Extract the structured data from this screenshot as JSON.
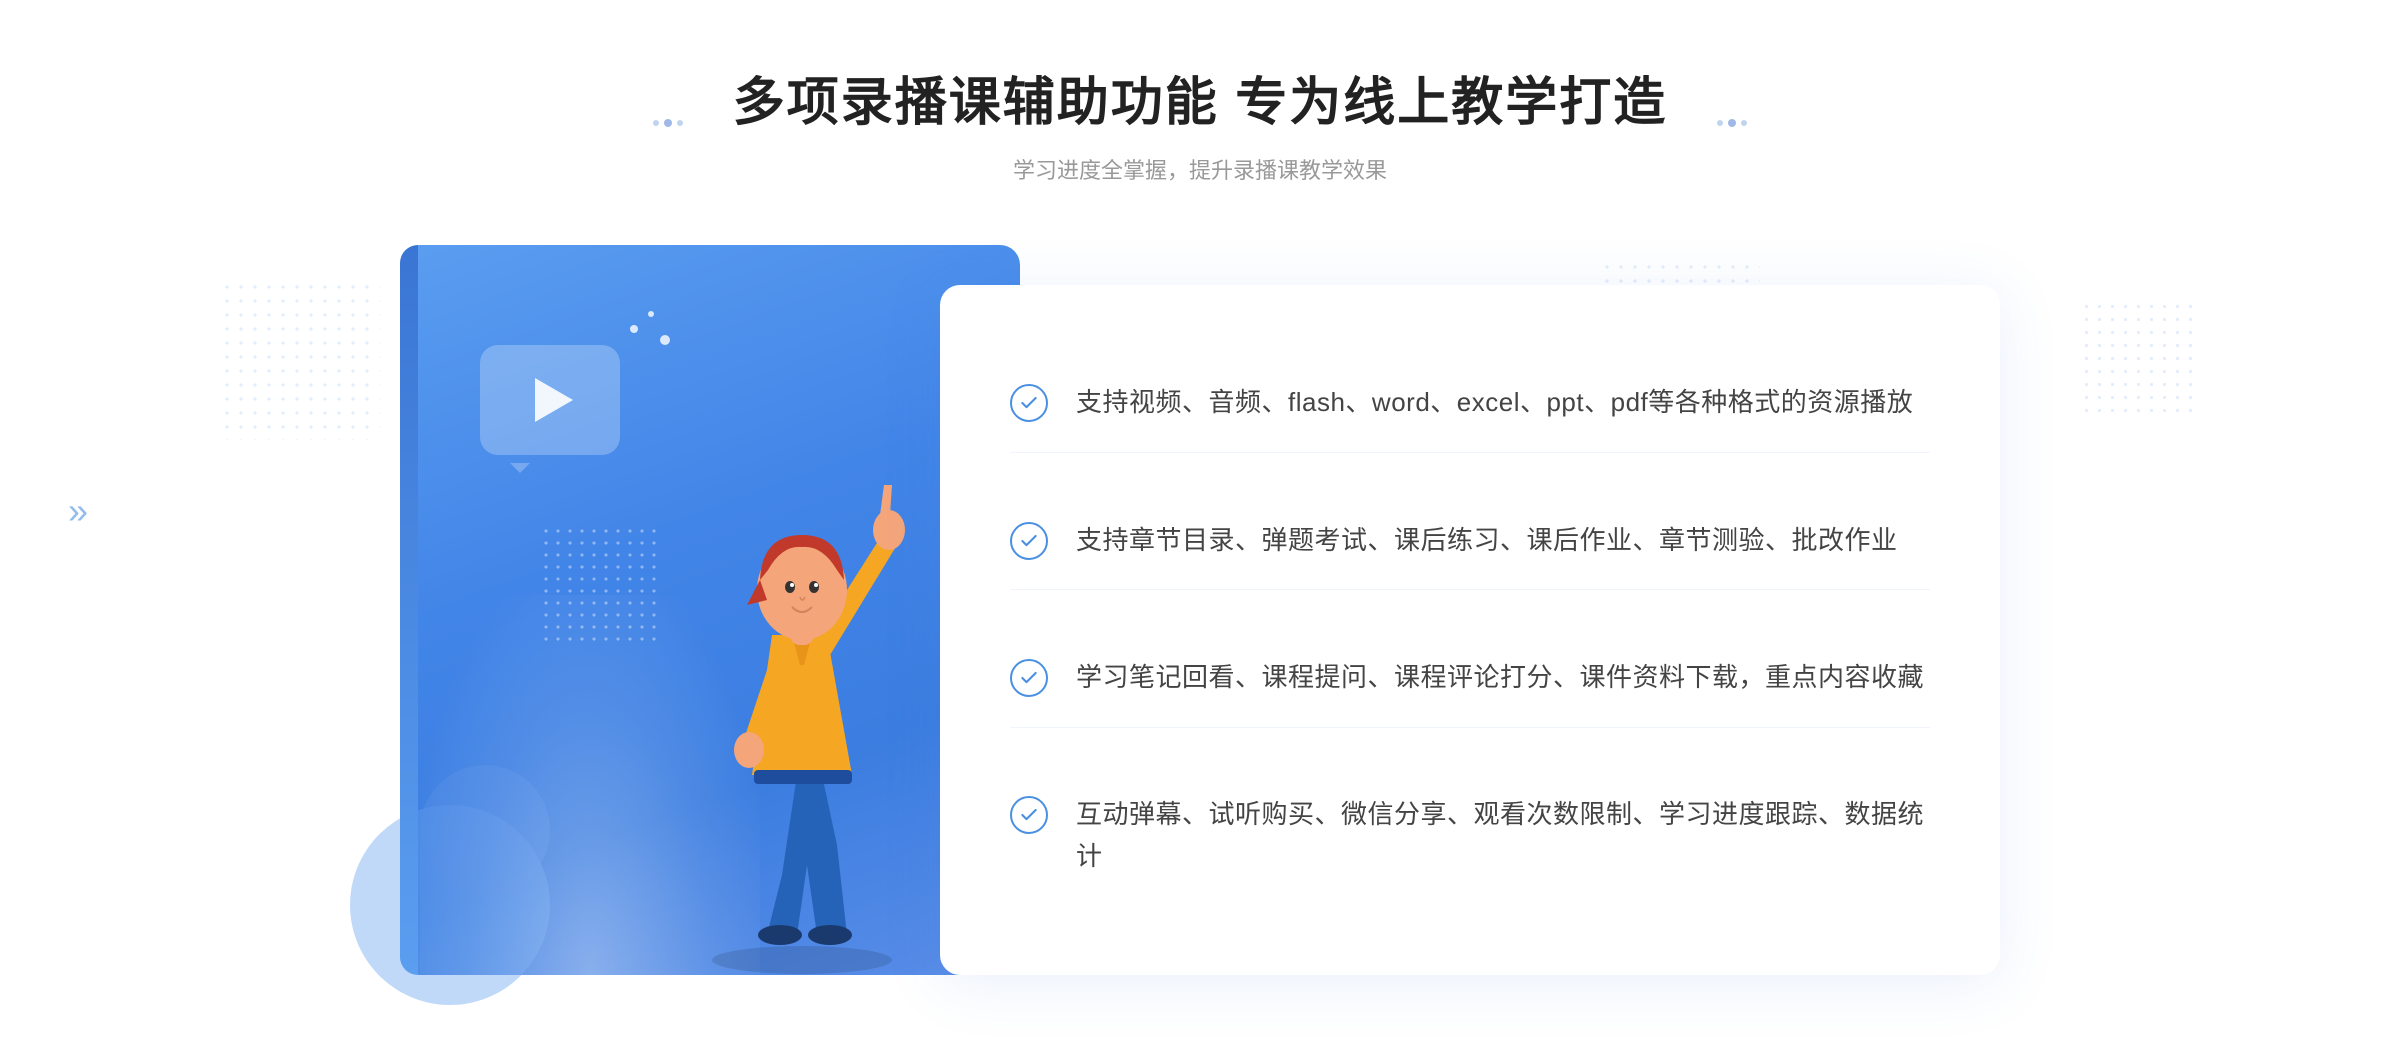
{
  "header": {
    "title": "多项录播课辅助功能 专为线上教学打造",
    "subtitle": "学习进度全掌握，提升录播课教学效果"
  },
  "features": [
    {
      "id": 1,
      "text": "支持视频、音频、flash、word、excel、ppt、pdf等各种格式的资源播放"
    },
    {
      "id": 2,
      "text": "支持章节目录、弹题考试、课后练习、课后作业、章节测验、批改作业"
    },
    {
      "id": 3,
      "text": "学习笔记回看、课程提问、课程评论打分、课件资料下载，重点内容收藏"
    },
    {
      "id": 4,
      "text": "互动弹幕、试听购买、微信分享、观看次数限制、学习进度跟踪、数据统计"
    }
  ],
  "decoration": {
    "chevron": "»",
    "play_label": "play"
  }
}
